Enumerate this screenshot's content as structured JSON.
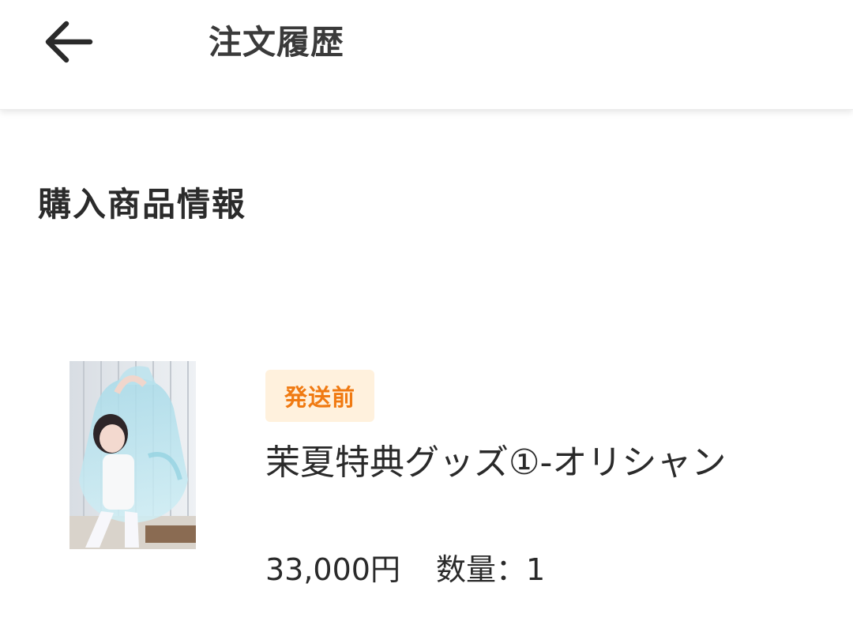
{
  "header": {
    "back_icon": "arrow-left-icon",
    "title": "注文履歴"
  },
  "section": {
    "title": "購入商品情報"
  },
  "order_item": {
    "status_label": "発送前",
    "status_text_color": "#f07a12",
    "status_bg_color": "#fff1dd",
    "name": "茉夏特典グッズ①-オリシャン",
    "price": "33,000円",
    "quantity": "数量：1"
  }
}
